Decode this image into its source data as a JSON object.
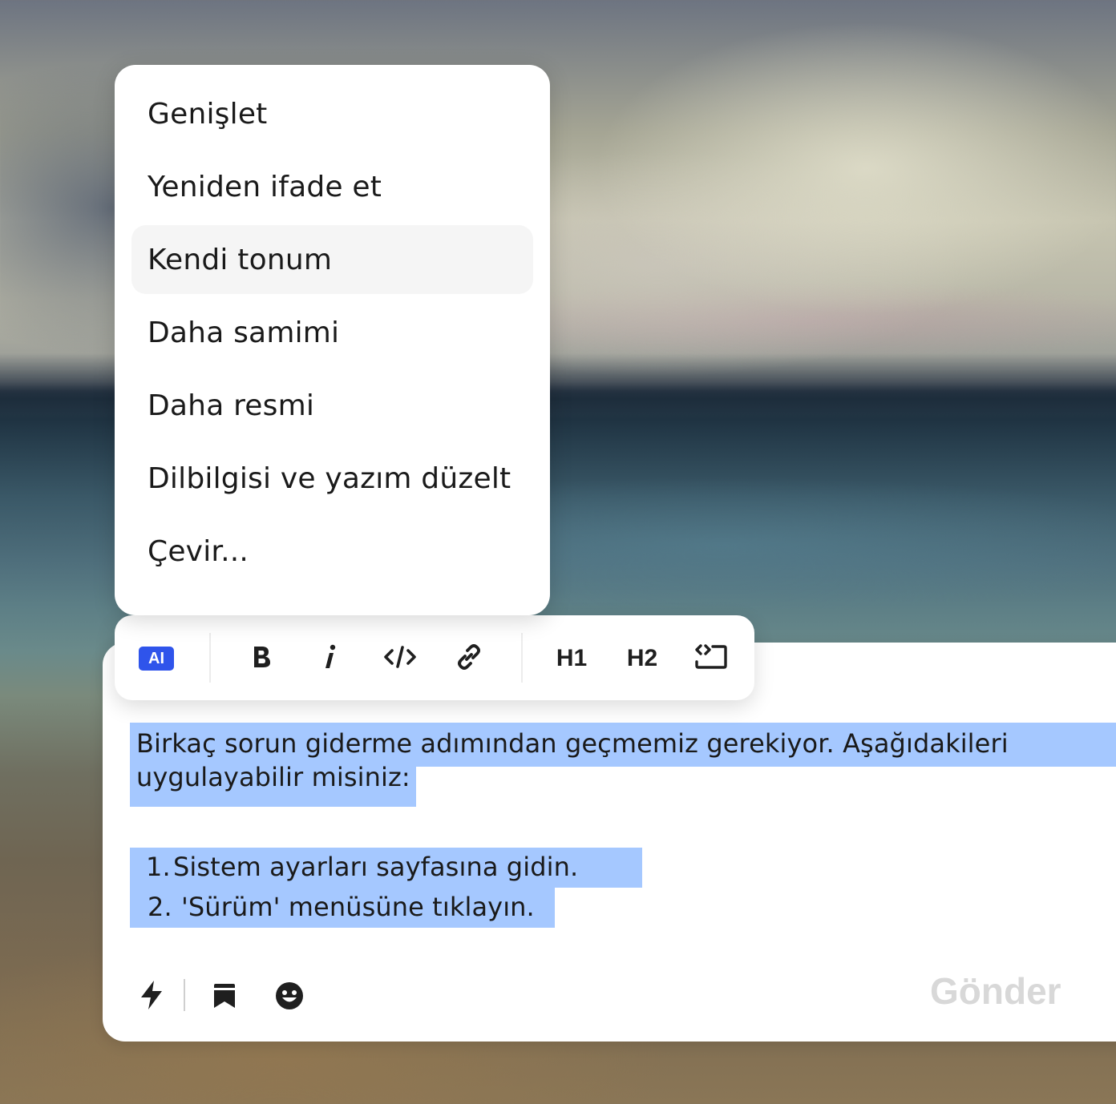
{
  "ai_menu": {
    "items": [
      {
        "label": "Genişlet",
        "active": false
      },
      {
        "label": "Yeniden ifade et",
        "active": false
      },
      {
        "label": "Kendi tonum",
        "active": true
      },
      {
        "label": "Daha samimi",
        "active": false
      },
      {
        "label": "Daha resmi",
        "active": false
      },
      {
        "label": "Dilbilgisi ve yazım düzelt",
        "active": false
      },
      {
        "label": "Çevir...",
        "active": false
      }
    ]
  },
  "toolbar": {
    "ai_label": "AI",
    "bold_icon": "bold-icon",
    "italic_icon": "italic-icon",
    "code_icon": "code-icon",
    "link_icon": "link-icon",
    "h1_label": "H1",
    "h2_label": "H2",
    "codeblock_icon": "code-block-icon"
  },
  "editor": {
    "paragraph_line1": "Birkaç sorun giderme adımından geçmemiz gerekiyor. Aşağıdakileri",
    "paragraph_line2": "uygulayabilir misiniz:",
    "list": [
      {
        "number": "1.",
        "text": "Sistem ayarları sayfasına gidin."
      },
      {
        "number": "2.",
        "text": "'Sürüm' menüsüne tıklayın."
      }
    ],
    "selection_color": "#a5c8ff"
  },
  "actions": {
    "send_label": "Gönder",
    "lightning_icon": "lightning-icon",
    "bookmark_icon": "bookmark-icon",
    "emoji_icon": "emoji-icon"
  },
  "colors": {
    "ai_badge": "#2f54eb",
    "send_disabled": "#d8d8d8"
  }
}
